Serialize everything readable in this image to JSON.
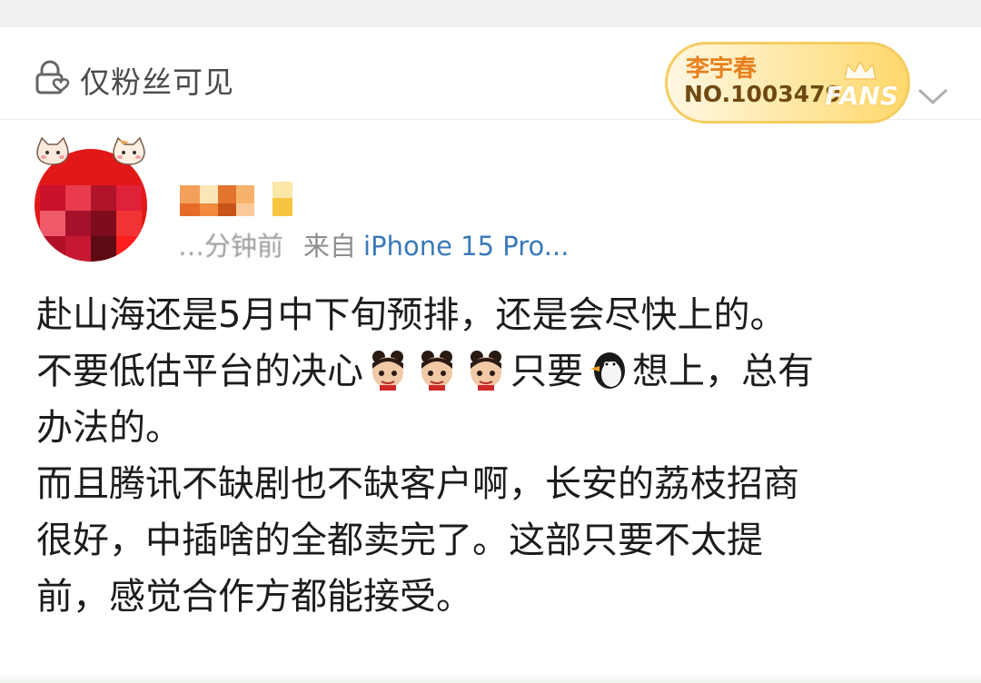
{
  "header": {
    "visibility_label": "仅粉丝可见",
    "icon": "lock-heart-icon"
  },
  "fan_badge": {
    "name": "李宇春",
    "number": "NO.1003479",
    "label": "FANS",
    "accent_color": "#e8801e"
  },
  "author": {
    "time_text": "…分钟前",
    "source_prefix": "来自",
    "device": "iPhone 15 Pro..."
  },
  "post": {
    "lines": [
      {
        "text": "赴山海还是5月中下旬预排，还是会尽快上的。"
      },
      {
        "before": "不要低估平台的决心",
        "middle": "只要",
        "after": "想上，总有"
      },
      {
        "text": "办法的。"
      },
      {
        "text": "而且腾讯不缺剧也不缺客户啊，长安的荔枝招商"
      },
      {
        "text": "很好，中插啥的全都卖完了。这部只要不太提"
      },
      {
        "text": "前，感觉合作方都能接受。"
      }
    ],
    "emojis": [
      "nezha-emoji",
      "nezha-emoji",
      "nezha-emoji",
      "penguin-emoji"
    ]
  }
}
